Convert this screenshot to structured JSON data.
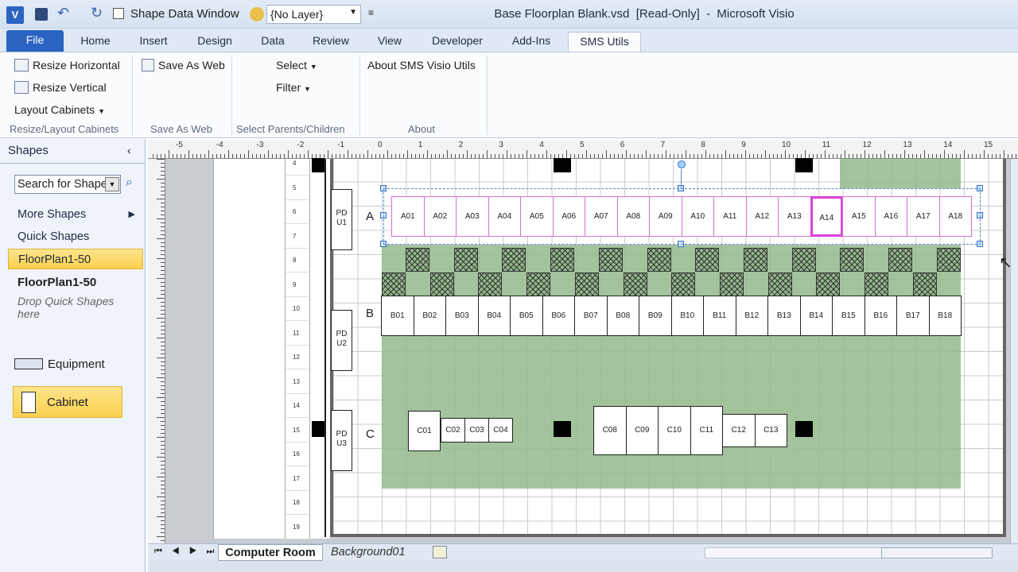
{
  "titlebar": {
    "quick_access_label": "Shape Data Window",
    "layer_value": "{No Layer}",
    "title": "Base Floorplan Blank.vsd  [Read-Only]  -  Microsoft Visio"
  },
  "tabs": [
    "File",
    "Home",
    "Insert",
    "Design",
    "Data",
    "Review",
    "View",
    "Developer",
    "Add-Ins",
    "SMS Utils"
  ],
  "ribbon": {
    "resize_horizontal": "Resize Horizontal",
    "resize_vertical": "Resize Vertical",
    "layout_cabinets": "Layout Cabinets",
    "group1": "Resize/Layout Cabinets",
    "save_as_web": "Save As Web",
    "group2": "Save As Web",
    "select": "Select",
    "filter": "Filter",
    "group3": "Select Parents/Children",
    "about_btn": "About SMS Visio Utils",
    "group4": "About"
  },
  "shapes": {
    "header": "Shapes",
    "search_placeholder": "Search for Shapes",
    "more_shapes": "More Shapes",
    "quick_shapes": "Quick Shapes",
    "stencil_selected": "FloorPlan1-50",
    "stencil_title": "FloorPlan1-50",
    "drop_hint": "Drop Quick Shapes here",
    "item_equipment": "Equipment",
    "item_cabinet": "Cabinet"
  },
  "ruler": {
    "h": [
      "-5",
      "-4",
      "-3",
      "-2",
      "-1",
      "0",
      "1",
      "2",
      "3",
      "4",
      "5",
      "6",
      "7",
      "8",
      "9",
      "10",
      "11",
      "12",
      "13",
      "14",
      "15"
    ],
    "v": [
      "4",
      "5",
      "6",
      "7",
      "8",
      "9",
      "10",
      "11",
      "12",
      "13",
      "14",
      "15",
      "16",
      "17",
      "18",
      "19"
    ]
  },
  "rows": {
    "a_label": "A",
    "b_label": "B",
    "c_label": "C",
    "pdu1": "PD U1",
    "pdu2": "PD U2",
    "pdu3": "PD U3",
    "a": [
      "A01",
      "A02",
      "A03",
      "A04",
      "A05",
      "A06",
      "A07",
      "A08",
      "A09",
      "A10",
      "A11",
      "A12",
      "A13",
      "A14",
      "A15",
      "A16",
      "A17",
      "A18"
    ],
    "b": [
      "B01",
      "B02",
      "B03",
      "B04",
      "B05",
      "B06",
      "B07",
      "B08",
      "B09",
      "B10",
      "B11",
      "B12",
      "B13",
      "B14",
      "B15",
      "B16",
      "B17",
      "B18"
    ],
    "c_small": [
      "C01",
      "C02",
      "C03",
      "C04"
    ],
    "c_large": [
      "C08",
      "C09",
      "C10",
      "C11",
      "C12",
      "C13"
    ]
  },
  "pages": {
    "active": "Computer Room",
    "background": "Background01"
  },
  "colors": {
    "green": "#93b88b",
    "selected": "#e040e0",
    "accent": "#2a63c1"
  }
}
